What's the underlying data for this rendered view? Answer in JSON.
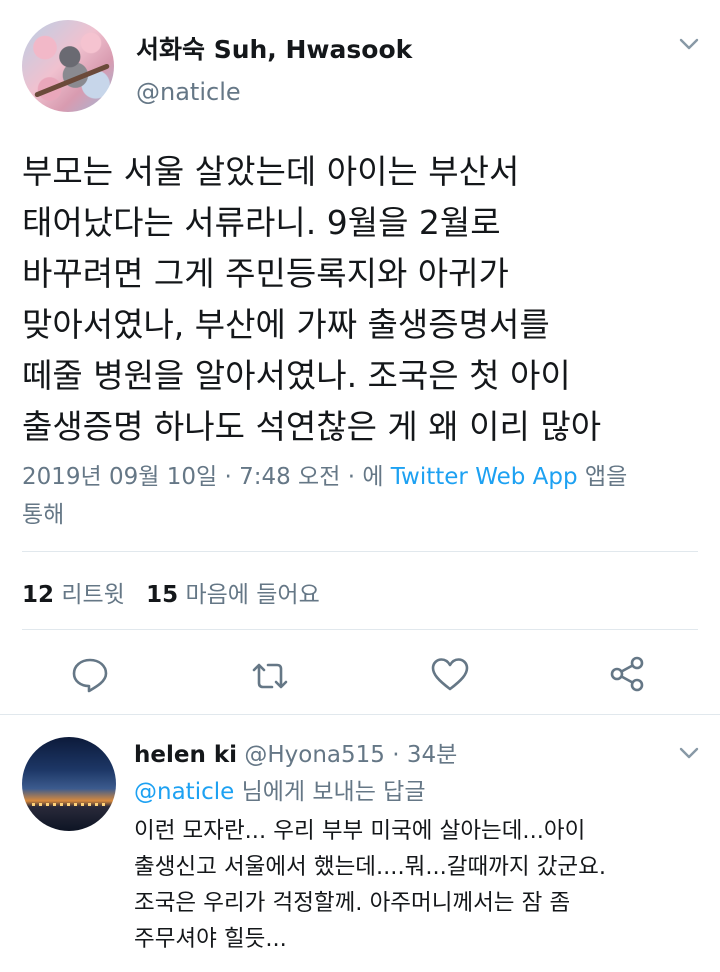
{
  "tweet": {
    "author_name": "서화숙 Suh, Hwasook",
    "author_handle": "@naticle",
    "text_lines": [
      "부모는 서울 살았는데 아이는 부산서",
      "태어났다는 서류라니. 9월을 2월로",
      "바꾸려면 그게 주민등록지와 아귀가",
      "맞아서였나, 부산에 가짜 출생증명서를",
      "떼줄 병원을 알아서였나. 조국은 첫 아이",
      "출생증명 하나도 석연찮은 게 왜 이리 많아"
    ],
    "timestamp": "2019년 09월 10일 · 7:48 오전 · 에 ",
    "source_app": "Twitter Web App",
    "source_suffix": " 앱을",
    "source_suffix2": "통해",
    "retweet_count": "12",
    "retweet_label": "리트윗",
    "like_count": "15",
    "like_label": "마음에 들어요"
  },
  "actions": {
    "icons": [
      "reply-icon",
      "retweet-icon",
      "like-icon",
      "share-icon"
    ]
  },
  "reply": {
    "author_name": "helen ki",
    "author_handle": "@Hyona515",
    "time": " · 34분",
    "replying_to_handle": "@naticle",
    "replying_to_suffix": " 님에게 보내는 답글",
    "text_lines": [
      "이런 모자란... 우리 부부 미국에 살아는데...아이",
      "출생신고 서울에서 했는데....뭐...갈때까지 갔군요.",
      "조국은 우리가 걱정할께. 아주머니께서는 잠 좀",
      "주무셔야 힐듯..."
    ]
  },
  "colors": {
    "accent": "#1da1f2",
    "secondary_text": "#657786",
    "divider": "#e1e8ed"
  }
}
